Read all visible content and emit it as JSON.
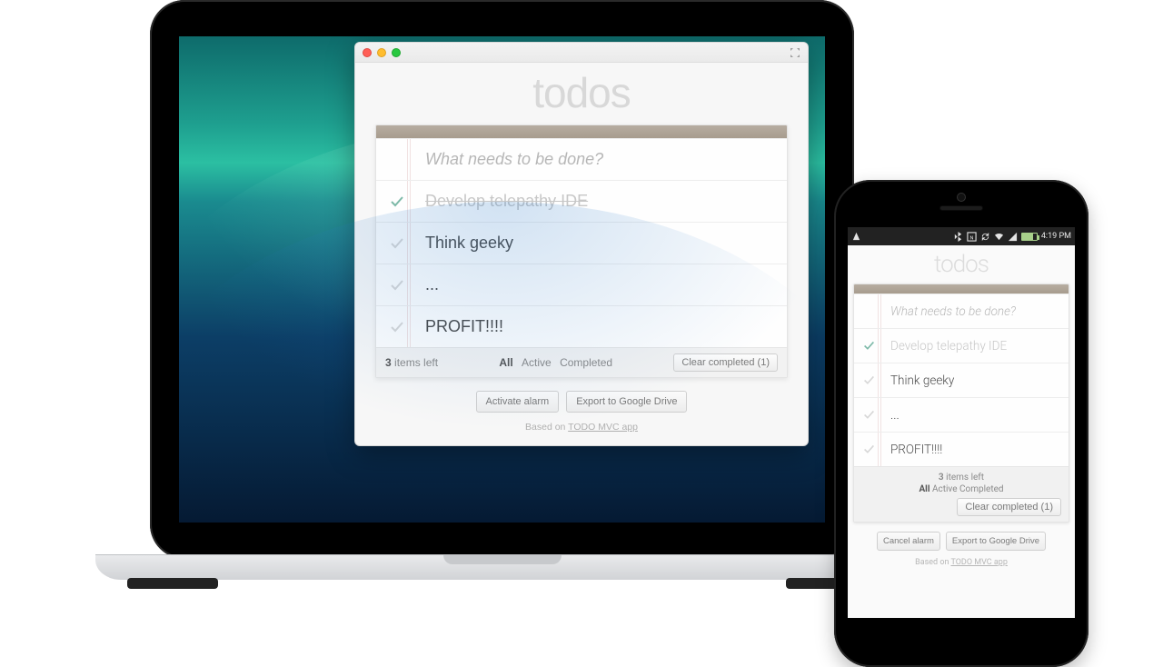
{
  "app_title": "todos",
  "input_placeholder": "What needs to be done?",
  "items": [
    {
      "text": "Develop telepathy IDE",
      "completed": true
    },
    {
      "text": "Think geeky",
      "completed": false
    },
    {
      "text": "...",
      "completed": false
    },
    {
      "text": "PROFIT!!!!",
      "completed": false
    }
  ],
  "footer": {
    "count_number": "3",
    "count_label": "items left",
    "filters": {
      "all": "All",
      "active": "Active",
      "completed": "Completed",
      "selected": "all"
    },
    "clear_label": "Clear completed (1)"
  },
  "desktop": {
    "actions": {
      "alarm": "Activate alarm",
      "export": "Export to Google Drive"
    }
  },
  "mobile": {
    "statusbar_time": "4:19 PM",
    "actions": {
      "alarm": "Cancel alarm",
      "export": "Export to Google Drive"
    }
  },
  "credit": {
    "prefix": "Based on ",
    "link": "TODO MVC app"
  }
}
